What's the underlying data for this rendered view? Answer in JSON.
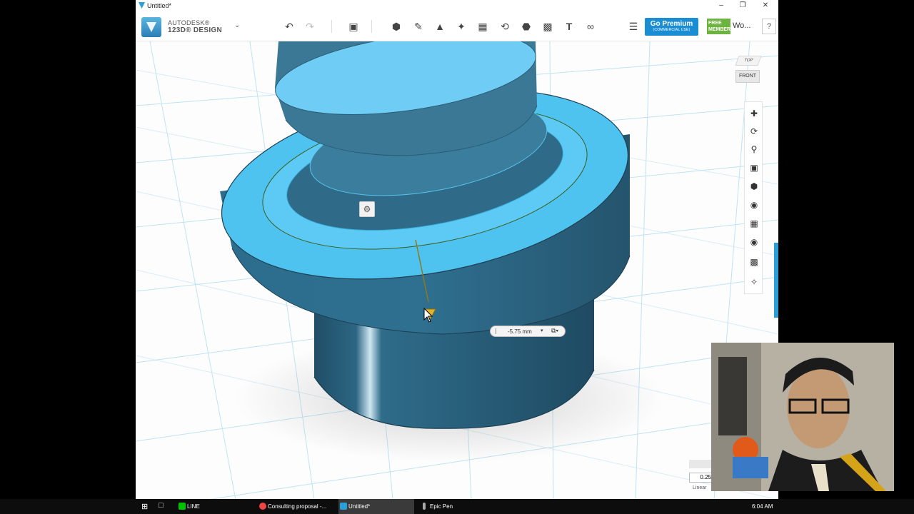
{
  "window": {
    "title": "Untitled*"
  },
  "toolbar": {
    "brand_line1": "AUTODESK®",
    "brand_line2": "123D® DESIGN",
    "brand_menu_icon": "chevron-down-icon",
    "undo_icon": "undo-icon",
    "redo_icon": "redo-icon",
    "tools": [
      "transform",
      "sketch",
      "construct",
      "modify",
      "pattern",
      "grouping",
      "combine",
      "measure",
      "snap",
      "text",
      "material"
    ],
    "premium_label": "Go Premium",
    "premium_sub": "(COMMERCIAL USE)",
    "free_badge": "FREE MEMBER",
    "user_label": "Wo...",
    "help_label": "?"
  },
  "viewcube": {
    "top": "TOP",
    "front": "FRONT"
  },
  "nav_tools": [
    "pan",
    "orbit",
    "zoom",
    "fit",
    "perspective",
    "visibility",
    "material",
    "screenshot",
    "grid",
    "snap"
  ],
  "dimension": {
    "value": "-5.75 mm"
  },
  "snap": {
    "value": "0.25",
    "label": "Linear"
  },
  "taskbar": {
    "items": [
      "LINE",
      "Consulting proposal -...",
      "Untitled*",
      "Epic Pen"
    ],
    "clock": "6:04 AM"
  },
  "colors": {
    "accent": "#1b8dd3",
    "model": "#2f6e8e",
    "model_highlight": "#4fc3f7",
    "grid": "#a9d6ee"
  }
}
